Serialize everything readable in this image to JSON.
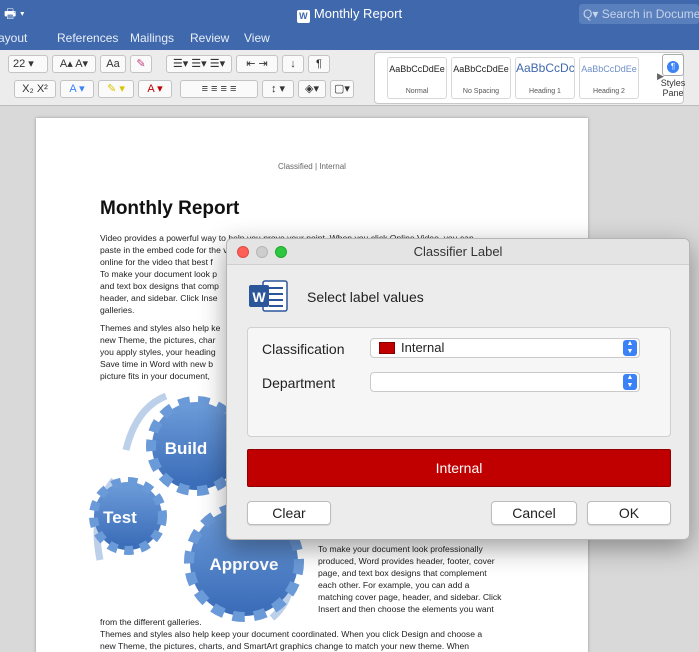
{
  "window": {
    "title": "Monthly Report",
    "search_placeholder": "Search in Document"
  },
  "tabs": [
    "ayout",
    "References",
    "Mailings",
    "Review",
    "View"
  ],
  "toolbar": {
    "font_size": "22",
    "styles": [
      {
        "sample": "AaBbCcDdEe",
        "name": "Normal"
      },
      {
        "sample": "AaBbCcDdEe",
        "name": "No Spacing"
      },
      {
        "sample": "AaBbCcDc",
        "name": "Heading 1"
      },
      {
        "sample": "AaBbCcDdEe",
        "name": "Heading 2"
      }
    ],
    "styles_pane_label": "Styles Pane"
  },
  "document": {
    "header_label": "Classified | Internal",
    "title": "Monthly Report",
    "paragraph1_lines": [
      "Video provides a powerful way to help you prove your point. When you click Online Video, you can",
      "paste in the embed code for the video you want to add. You can also type a keyword to search",
      "online for the video that best f",
      "To make your document look p",
      "and text box designs that comp",
      "header, and sidebar. Click Inse",
      "galleries."
    ],
    "paragraph2_lines": [
      "Themes and styles also help ke",
      "new Theme, the pictures, char",
      "you apply styles, your heading",
      "Save time in Word with new b",
      "picture fits in your document, "
    ],
    "diagram_labels": {
      "build": "Build",
      "test": "Test",
      "approve": "Approve"
    },
    "right_column_lines": [
      "To make your document look professionally",
      "produced, Word provides header, footer, cover",
      "page, and text box designs that complement",
      "each other. For example, you can add a",
      "matching cover page, header, and sidebar. Click",
      "Insert and then choose the elements you want"
    ],
    "bottom_lines": [
      "from the different galleries.",
      "Themes and styles also help keep your document coordinated. When you click Design and choose a",
      "new Theme, the pictures, charts, and SmartArt graphics change to match your new theme. When"
    ]
  },
  "dialog": {
    "title": "Classifier Label",
    "subtitle": "Select label values",
    "fields": [
      {
        "label": "Classification",
        "value": "Internal"
      },
      {
        "label": "Department",
        "value": ""
      }
    ],
    "label_bar_text": "Internal",
    "buttons": {
      "clear": "Clear",
      "cancel": "Cancel",
      "ok": "OK"
    }
  },
  "colors": {
    "title_bar": "#3f68ad",
    "label_red": "#c00000",
    "stepper_blue": "#3b82f6",
    "gear_blue": "#4a7dc4"
  }
}
